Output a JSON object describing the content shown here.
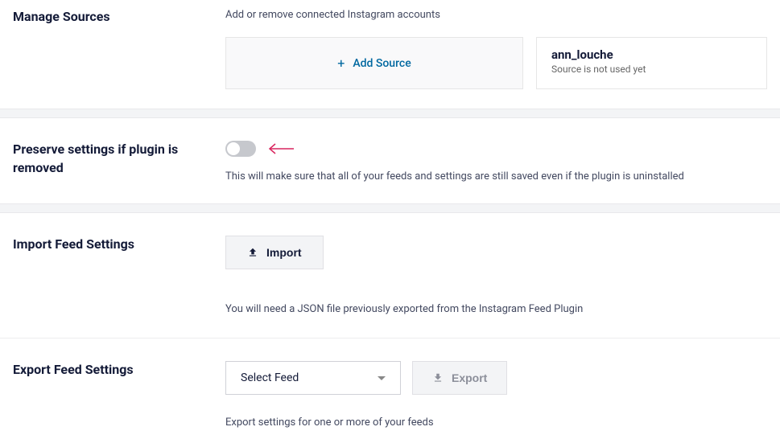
{
  "manage_sources": {
    "title": "Manage Sources",
    "subtext": "Add or remove connected Instagram accounts",
    "add_label": "Add Source",
    "source": {
      "name": "ann_louche",
      "status": "Source is not used yet"
    }
  },
  "preserve": {
    "title": "Preserve settings if plugin is removed",
    "description": "This will make sure that all of your feeds and settings are still saved even if the plugin is uninstalled"
  },
  "import": {
    "title": "Import Feed Settings",
    "button": "Import",
    "help": "You will need a JSON file previously exported from the Instagram Feed Plugin"
  },
  "export": {
    "title": "Export Feed Settings",
    "select": "Select Feed",
    "button": "Export",
    "help": "Export settings for one or more of your feeds"
  }
}
